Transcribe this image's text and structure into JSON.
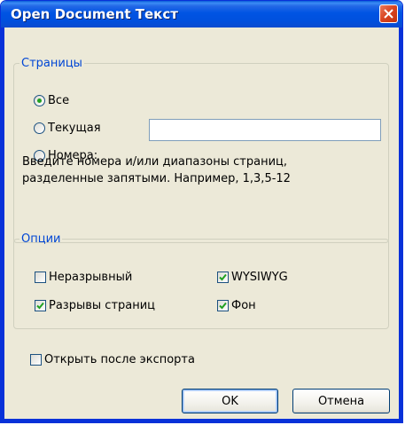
{
  "window": {
    "title": "Open Document Текст"
  },
  "pages_group": {
    "legend": "Страницы",
    "options": [
      {
        "label": "Все",
        "selected": true
      },
      {
        "label": "Текущая",
        "selected": false
      },
      {
        "label": "Номера:",
        "selected": false
      }
    ],
    "range_input_value": "",
    "hint_line1": "Введите номера и/или диапазоны страниц,",
    "hint_line2": "разделенные запятыми. Например, 1,3,5-12"
  },
  "options_group": {
    "legend": "Опции",
    "checkboxes": [
      {
        "label": "Неразрывный",
        "checked": false
      },
      {
        "label": "WYSIWYG",
        "checked": true
      },
      {
        "label": "Разрывы страниц",
        "checked": true
      },
      {
        "label": "Фон",
        "checked": true
      }
    ]
  },
  "open_after_export": {
    "label": "Открыть после экспорта",
    "checked": false
  },
  "buttons": {
    "ok": "OK",
    "cancel": "Отмена"
  },
  "colors": {
    "titlebar": "#0054e3",
    "group_legend": "#0046d5",
    "check_mark": "#21a121",
    "dialog_bg": "#ece9d8"
  }
}
